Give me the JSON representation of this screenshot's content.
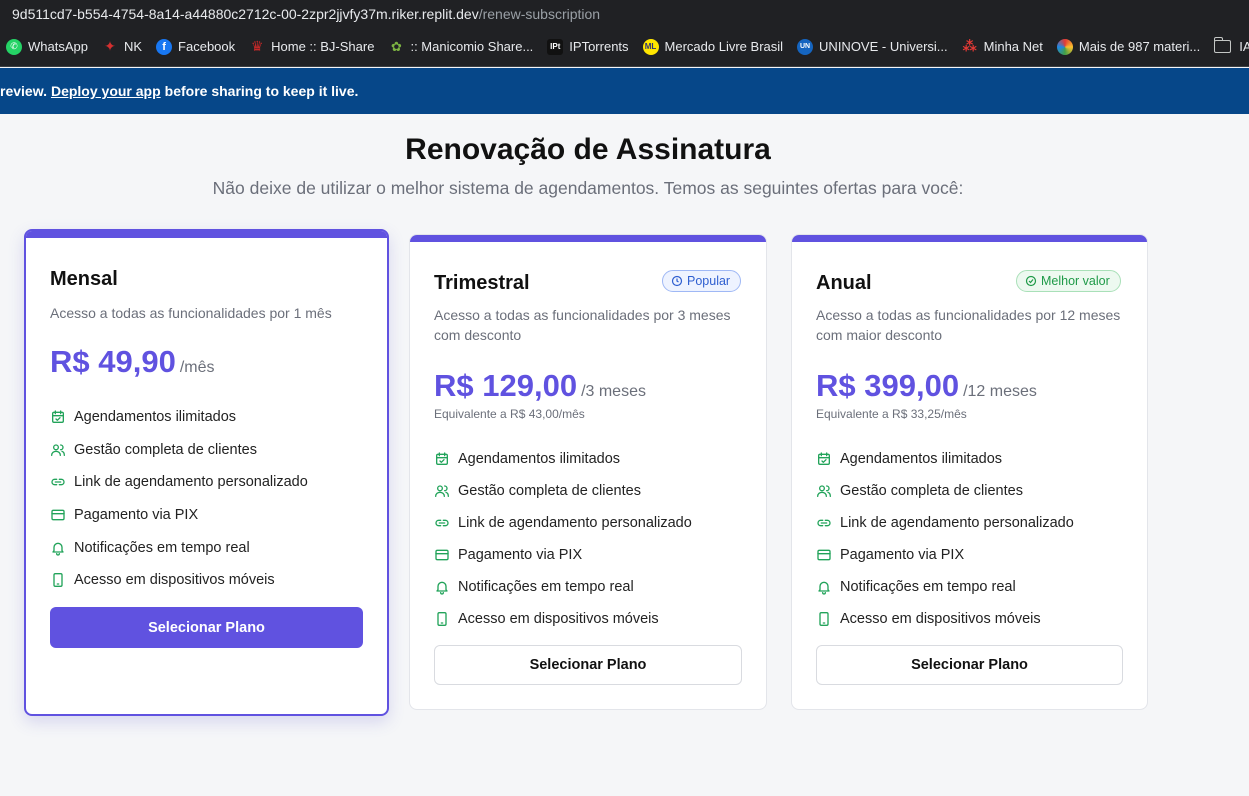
{
  "browser": {
    "url_host": "9d511cd7-b554-4754-8a14-a44880c2712c-00-2zpr2jjvfy37m.riker.replit.dev",
    "url_path": "/renew-subscription",
    "bookmarks": [
      {
        "label": "WhatsApp",
        "icon": "whatsapp-icon",
        "color": "#25d366"
      },
      {
        "label": "NK",
        "icon": "maple-leaf-icon",
        "color": "#d32f2f"
      },
      {
        "label": "Facebook",
        "icon": "facebook-icon",
        "color": "#1877f2"
      },
      {
        "label": "Home :: BJ-Share",
        "icon": "bjshare-icon",
        "color": "#c62828"
      },
      {
        "label": ":: Manicomio Share...",
        "icon": "manicomio-icon",
        "color": "#7cb342"
      },
      {
        "label": "IPTorrents",
        "icon": "iptorrents-icon",
        "color": "#333333"
      },
      {
        "label": "Mercado Livre Brasil",
        "icon": "mercadolivre-icon",
        "color": "#ffe600"
      },
      {
        "label": "UNINOVE - Universi...",
        "icon": "uninove-icon",
        "color": "#1565c0"
      },
      {
        "label": "Minha Net",
        "icon": "minhanet-icon",
        "color": "#e53935"
      },
      {
        "label": "Mais de 987 materi...",
        "icon": "colorful-ball-icon",
        "color": "#fbc02d"
      },
      {
        "label": "IA",
        "icon": "folder-icon",
        "color": "#c4c7c5"
      }
    ]
  },
  "banner": {
    "prefix": "review.",
    "link": "Deploy your app",
    "suffix": "before sharing to keep it live."
  },
  "header": {
    "title": "Renovação de Assinatura",
    "subtitle": "Não deixe de utilizar o melhor sistema de agendamentos. Temos as seguintes ofertas para você:"
  },
  "plans": [
    {
      "name": "Mensal",
      "description": "Acesso a todas as funcionalidades por 1 mês",
      "price": "R$ 49,90",
      "period": "/mês",
      "equivalent": "",
      "badge": "",
      "selected": true,
      "button": "Selecionar Plano"
    },
    {
      "name": "Trimestral",
      "description_line1": "Acesso a todas as funcionalidades por 3 meses",
      "description_line2": "com desconto",
      "price": "R$ 129,00",
      "period": "/3 meses",
      "equivalent": "Equivalente a R$ 43,00/mês",
      "badge": "Popular",
      "selected": false,
      "button": "Selecionar Plano"
    },
    {
      "name": "Anual",
      "description_line1": "Acesso a todas as funcionalidades por 12 meses",
      "description_line2": "com maior desconto",
      "price": "R$ 399,00",
      "period": "/12 meses",
      "equivalent": "Equivalente a R$ 33,25/mês",
      "badge": "Melhor valor",
      "selected": false,
      "button": "Selecionar Plano"
    }
  ],
  "features": [
    {
      "label": "Agendamentos ilimitados",
      "icon": "calendar-check-icon"
    },
    {
      "label": "Gestão completa de clientes",
      "icon": "users-icon"
    },
    {
      "label": "Link de agendamento personalizado",
      "icon": "link-icon"
    },
    {
      "label": "Pagamento via PIX",
      "icon": "credit-card-icon"
    },
    {
      "label": "Notificações em tempo real",
      "icon": "bell-icon"
    },
    {
      "label": "Acesso em dispositivos móveis",
      "icon": "smartphone-icon"
    }
  ],
  "colors": {
    "accent": "#6052e0",
    "feature_icon": "#22a35a",
    "banner": "#064789"
  }
}
